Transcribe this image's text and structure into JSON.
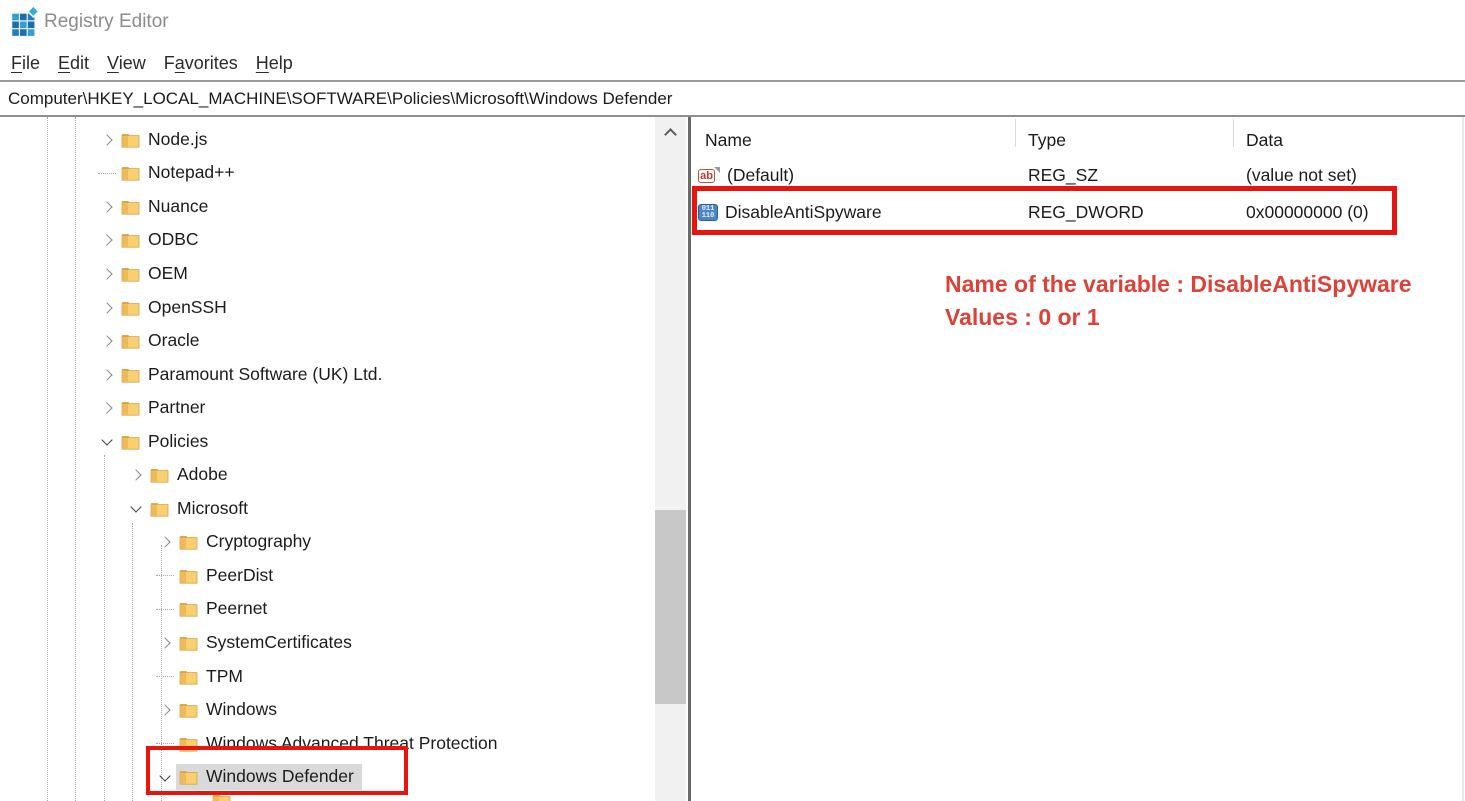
{
  "window": {
    "title": "Registry Editor",
    "app_icon": "registry-editor-icon"
  },
  "menu": {
    "items": [
      {
        "pre": "",
        "accel": "F",
        "post": "ile"
      },
      {
        "pre": "",
        "accel": "E",
        "post": "dit"
      },
      {
        "pre": "",
        "accel": "V",
        "post": "iew"
      },
      {
        "pre": "F",
        "accel": "a",
        "post": "vorites"
      },
      {
        "pre": "",
        "accel": "H",
        "post": "elp"
      }
    ]
  },
  "address": {
    "value": "Computer\\HKEY_LOCAL_MACHINE\\SOFTWARE\\Policies\\Microsoft\\Windows Defender"
  },
  "tree": {
    "scroll_up_icon": "chevron-up-icon",
    "items": [
      {
        "label": "Node.js",
        "level": 0,
        "expander": "collapsed"
      },
      {
        "label": "Notepad++",
        "level": 0,
        "expander": "none"
      },
      {
        "label": "Nuance",
        "level": 0,
        "expander": "collapsed"
      },
      {
        "label": "ODBC",
        "level": 0,
        "expander": "collapsed"
      },
      {
        "label": "OEM",
        "level": 0,
        "expander": "collapsed"
      },
      {
        "label": "OpenSSH",
        "level": 0,
        "expander": "collapsed"
      },
      {
        "label": "Oracle",
        "level": 0,
        "expander": "collapsed"
      },
      {
        "label": "Paramount Software (UK) Ltd.",
        "level": 0,
        "expander": "collapsed"
      },
      {
        "label": "Partner",
        "level": 0,
        "expander": "collapsed"
      },
      {
        "label": "Policies",
        "level": 0,
        "expander": "expanded"
      },
      {
        "label": "Adobe",
        "level": 1,
        "expander": "collapsed"
      },
      {
        "label": "Microsoft",
        "level": 1,
        "expander": "expanded"
      },
      {
        "label": "Cryptography",
        "level": 2,
        "expander": "collapsed"
      },
      {
        "label": "PeerDist",
        "level": 2,
        "expander": "none"
      },
      {
        "label": "Peernet",
        "level": 2,
        "expander": "none"
      },
      {
        "label": "SystemCertificates",
        "level": 2,
        "expander": "collapsed"
      },
      {
        "label": "TPM",
        "level": 2,
        "expander": "none"
      },
      {
        "label": "Windows",
        "level": 2,
        "expander": "collapsed"
      },
      {
        "label": "Windows Advanced Threat Protection",
        "level": 2,
        "expander": "none"
      },
      {
        "label": "Windows Defender",
        "level": 2,
        "expander": "expanded",
        "selected": true
      }
    ]
  },
  "value_list": {
    "columns": [
      "Name",
      "Type",
      "Data"
    ],
    "rows": [
      {
        "icon": "string-value-icon",
        "name": "(Default)",
        "type": "REG_SZ",
        "data": "(value not set)"
      },
      {
        "icon": "dword-value-icon",
        "name": "DisableAntiSpyware",
        "type": "REG_DWORD",
        "data": "0x00000000 (0)",
        "highlighted": true
      }
    ]
  },
  "annotations": {
    "note_line1": "Name of the variable : DisableAntiSpyware",
    "note_line2": "Values : 0 or 1",
    "highlight_color": "#e8150f",
    "note_color": "#dd4238"
  },
  "colors": {
    "selection": "#d9d9d9",
    "folder": "#f9cf6f",
    "icon_blue": "#1d7ec4"
  }
}
